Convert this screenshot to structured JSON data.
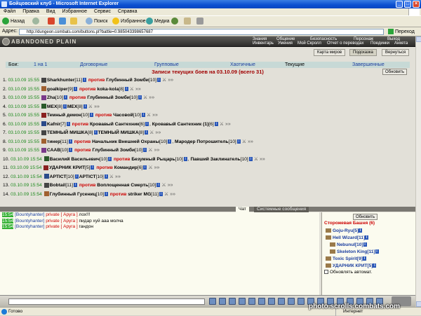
{
  "window": {
    "title": "Бойцовский клуб - Microsoft Internet Explorer",
    "min": "_",
    "max": "□",
    "close": "×"
  },
  "menu": [
    "Файл",
    "Правка",
    "Вид",
    "Избранное",
    "Сервис",
    "Справка"
  ],
  "toolbar": {
    "back": "Назад",
    "search": "Поиск",
    "favorites": "Избранное",
    "media": "Медиа"
  },
  "address": {
    "label": "Адрес:",
    "url": "http://dungeon.combats.com/buttons.pl?battle=0.985043398657687",
    "go": "Переход"
  },
  "banner": {
    "logo": "ABANDONED PLAIN",
    "nav_top": [
      "Знания",
      "Общение",
      "Безопасность",
      "Персонаж",
      "Выход"
    ],
    "nav_bottom": [
      "Инвентарь",
      "Умения",
      "Мой Скролл",
      "Отчет о переводах",
      "Поединки",
      "Анкета"
    ]
  },
  "subnav": [
    "Карта миров",
    "Подсказка",
    "Вернуться"
  ],
  "tabs": {
    "label": "Бои:",
    "items": [
      "1 на 1",
      "Договорные",
      "Групповые",
      "Хаотичные",
      "Текущие",
      "Завершенные"
    ]
  },
  "heading": "Записи текущих боев на 03.10.09 (всего 31)",
  "refresh": "Обновить",
  "battles": [
    {
      "num": "1.",
      "time": "03.10.09 15:55",
      "a": "Sharkhunter",
      "al": "[11]",
      "vs": "против",
      "b": "Глубинный Зомби",
      "bl": "[10]",
      "c": "",
      "cl": ""
    },
    {
      "num": "2.",
      "time": "03.10.09 15:55",
      "a": "goalkiper",
      "al": "[9]",
      "vs": "против",
      "b": "koka-kola",
      "bl": "[8]",
      "c": "",
      "cl": ""
    },
    {
      "num": "3.",
      "time": "03.10.09 15:55",
      "a": "Zha",
      "al": "[10]",
      "vs": "против",
      "b": "Глубинный Зомби",
      "bl": "[10]",
      "c": "",
      "cl": ""
    },
    {
      "num": "4.",
      "time": "03.10.09 15:55",
      "a": "MEX",
      "al": "[8]",
      "vs": "",
      "b": "MEX",
      "bl": "[8]",
      "c": "",
      "cl": ""
    },
    {
      "num": "5.",
      "time": "03.10.09 15:55",
      "a": "Темный демон",
      "al": "[10]",
      "vs": "против",
      "b": "Часовой",
      "bl": "[10]",
      "c": "",
      "cl": ""
    },
    {
      "num": "6.",
      "time": "03.10.09 15:55",
      "a": "Kafnir",
      "al": "[7]",
      "vs": "против",
      "b": "Кровавый Сантехник",
      "bl": "[6]",
      "c": "Кровавый Сантехник (1)",
      "cl": "[6]"
    },
    {
      "num": "7.",
      "time": "03.10.09 15:55",
      "a": "ТЕМНЫЙ МИШКА",
      "al": "[8]",
      "vs": "",
      "b": "ТЕМНЫЙ МИШКА",
      "bl": "[8]",
      "c": "",
      "cl": ""
    },
    {
      "num": "8.",
      "time": "03.10.09 15:55",
      "a": "тинер",
      "al": "[11]",
      "vs": "против",
      "b": "Начальник Внешней Охраны",
      "bl": "[10]",
      "c": "Мародер Потрошитель",
      "cl": "[10]"
    },
    {
      "num": "9.",
      "time": "03.10.09 15:55",
      "a": "СААВ",
      "al": "[10]",
      "vs": "против",
      "b": "Глубинный Зомби",
      "bl": "[10]",
      "c": "",
      "cl": ""
    },
    {
      "num": "10.",
      "time": "03.10.09 15:54",
      "a": "Василий Васильевич",
      "al": "[10]",
      "vs": "против",
      "b": "Безумный Рыцарь",
      "bl": "[10]",
      "c": "Павший Заклинатель",
      "cl": "[10]"
    },
    {
      "num": "11.",
      "time": "03.10.09 15:54",
      "a": "УДАРНИК КРИТ",
      "al": "[5]",
      "vs": "против",
      "b": "Командир",
      "bl": "[6]",
      "c": "",
      "cl": ""
    },
    {
      "num": "12.",
      "time": "03.10.09 15:54",
      "a": "АРТIСТ",
      "al": "[10]",
      "vs": "",
      "b": "АРТIСТ",
      "bl": "[10]",
      "c": "",
      "cl": ""
    },
    {
      "num": "13.",
      "time": "03.10.09 15:54",
      "a": "Bobtail",
      "al": "[11]",
      "vs": "против",
      "b": "Воплощенная Смерть",
      "bl": "[10]",
      "c": "",
      "cl": ""
    },
    {
      "num": "14.",
      "time": "03.10.09 15:54",
      "a": "Глубинный Гусениц",
      "al": "[10]",
      "vs": "против",
      "b": "striker MG",
      "bl": "[11]",
      "c": "",
      "cl": ""
    }
  ],
  "chat": {
    "tabs": [
      "Чат",
      "Системные сообщения"
    ],
    "lines": [
      {
        "time": "15:54",
        "from": "[Bountyhanter]",
        "priv": "private [ Аруга ]",
        "msg": "лох!!!"
      },
      {
        "time": "15:54",
        "from": "[Bountyhanter]",
        "priv": "private [ Аруга ]",
        "msg": "пидар хуй ааа молча"
      },
      {
        "time": "15:54",
        "from": "[Bountyhanter]",
        "priv": "private [ Аруга ]",
        "msg": "гандон"
      }
    ]
  },
  "online": {
    "refresh": "Обновить",
    "location": "Сторожевая Башня (6)",
    "users": [
      {
        "name": "Goju-Ryu",
        "lvl": "[5]"
      },
      {
        "name": "Hell Wizard",
        "lvl": "[11]"
      },
      {
        "name": "Nebunul",
        "lvl": "[10]"
      },
      {
        "name": "Skeleton King",
        "lvl": "[11]"
      },
      {
        "name": "Toxic Spirit",
        "lvl": "[9]"
      },
      {
        "name": "УДАРНИК КРИТ",
        "lvl": "[5]"
      }
    ],
    "auto": "Обновлять автомат."
  },
  "statusbar": {
    "text": "Готово",
    "zone": "Интернет"
  },
  "watermark": "photo.scrolls.combats.com"
}
